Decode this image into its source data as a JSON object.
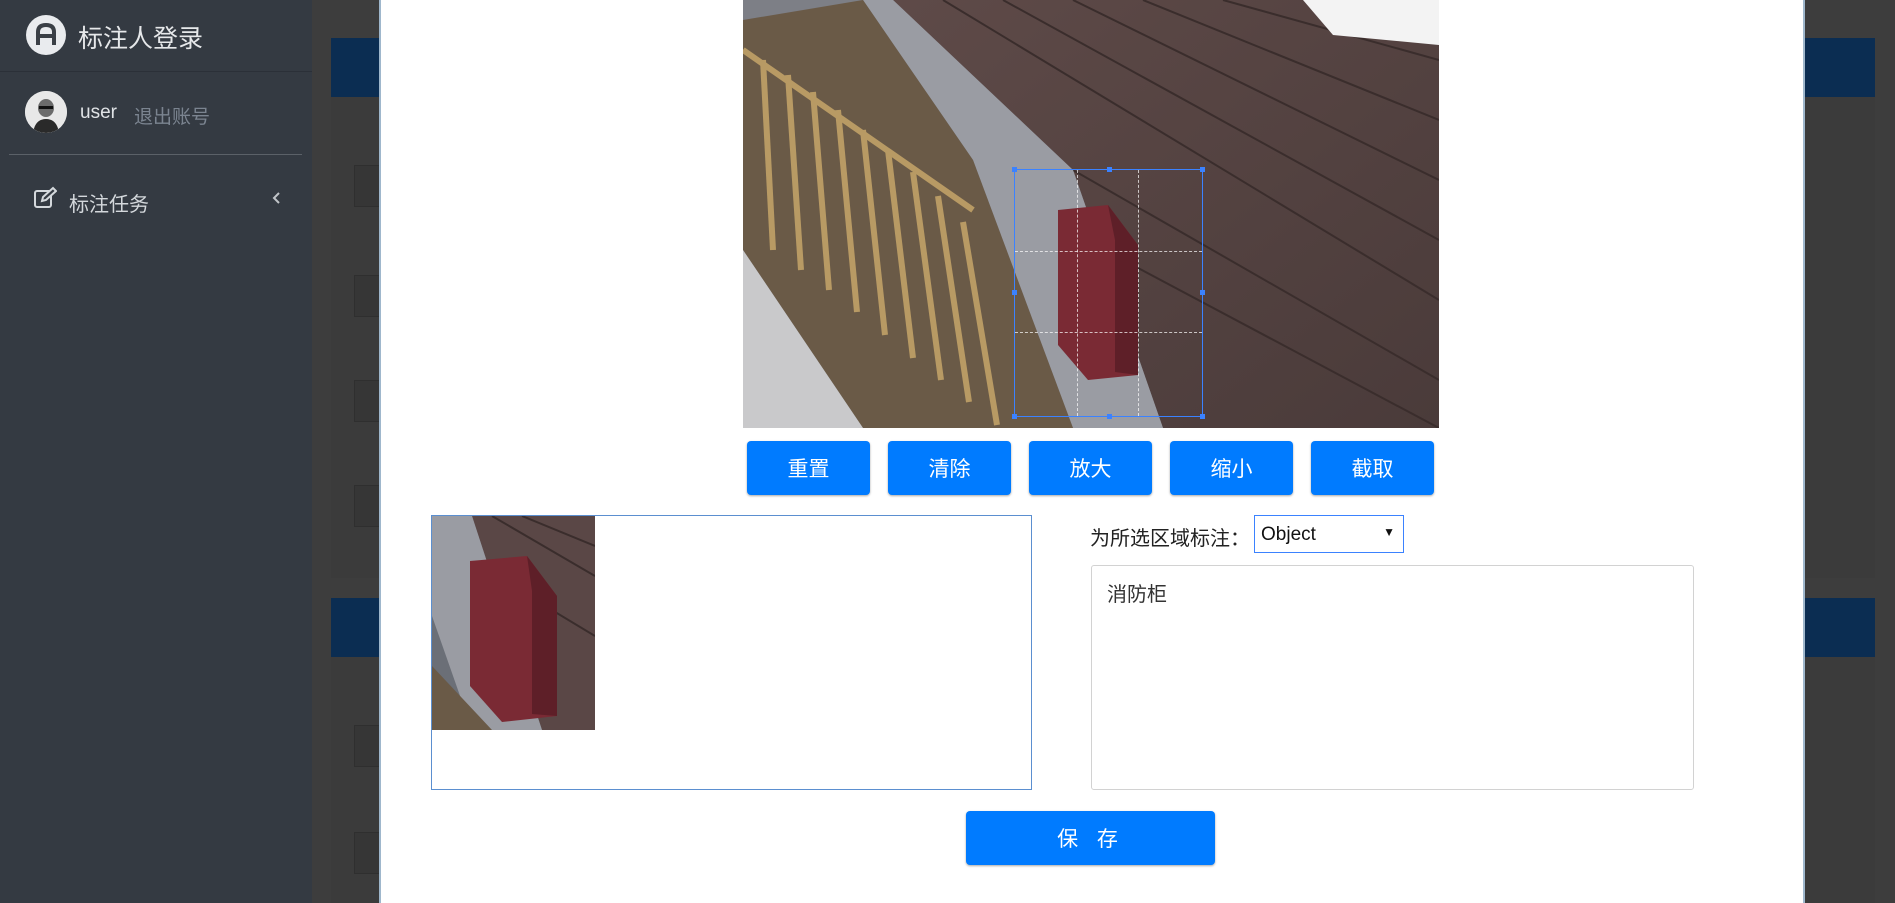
{
  "app": {
    "title": "标注人登录"
  },
  "user": {
    "name": "user",
    "logout_label": "退出账号"
  },
  "sidebar": {
    "items": [
      {
        "label": "标注任务",
        "icon": "edit-icon"
      }
    ]
  },
  "modal": {
    "toolbar": {
      "reset_label": "重置",
      "clear_label": "清除",
      "zoom_in_label": "放大",
      "zoom_out_label": "缩小",
      "crop_label": "截取"
    },
    "annotate_label": "为所选区域标注：",
    "category_select": {
      "value": "Object"
    },
    "description": "消防柜",
    "save_label": "保 存"
  },
  "colors": {
    "accent": "#007bff",
    "sidebar_bg": "#343a42",
    "crop_border": "#3b82ff"
  }
}
